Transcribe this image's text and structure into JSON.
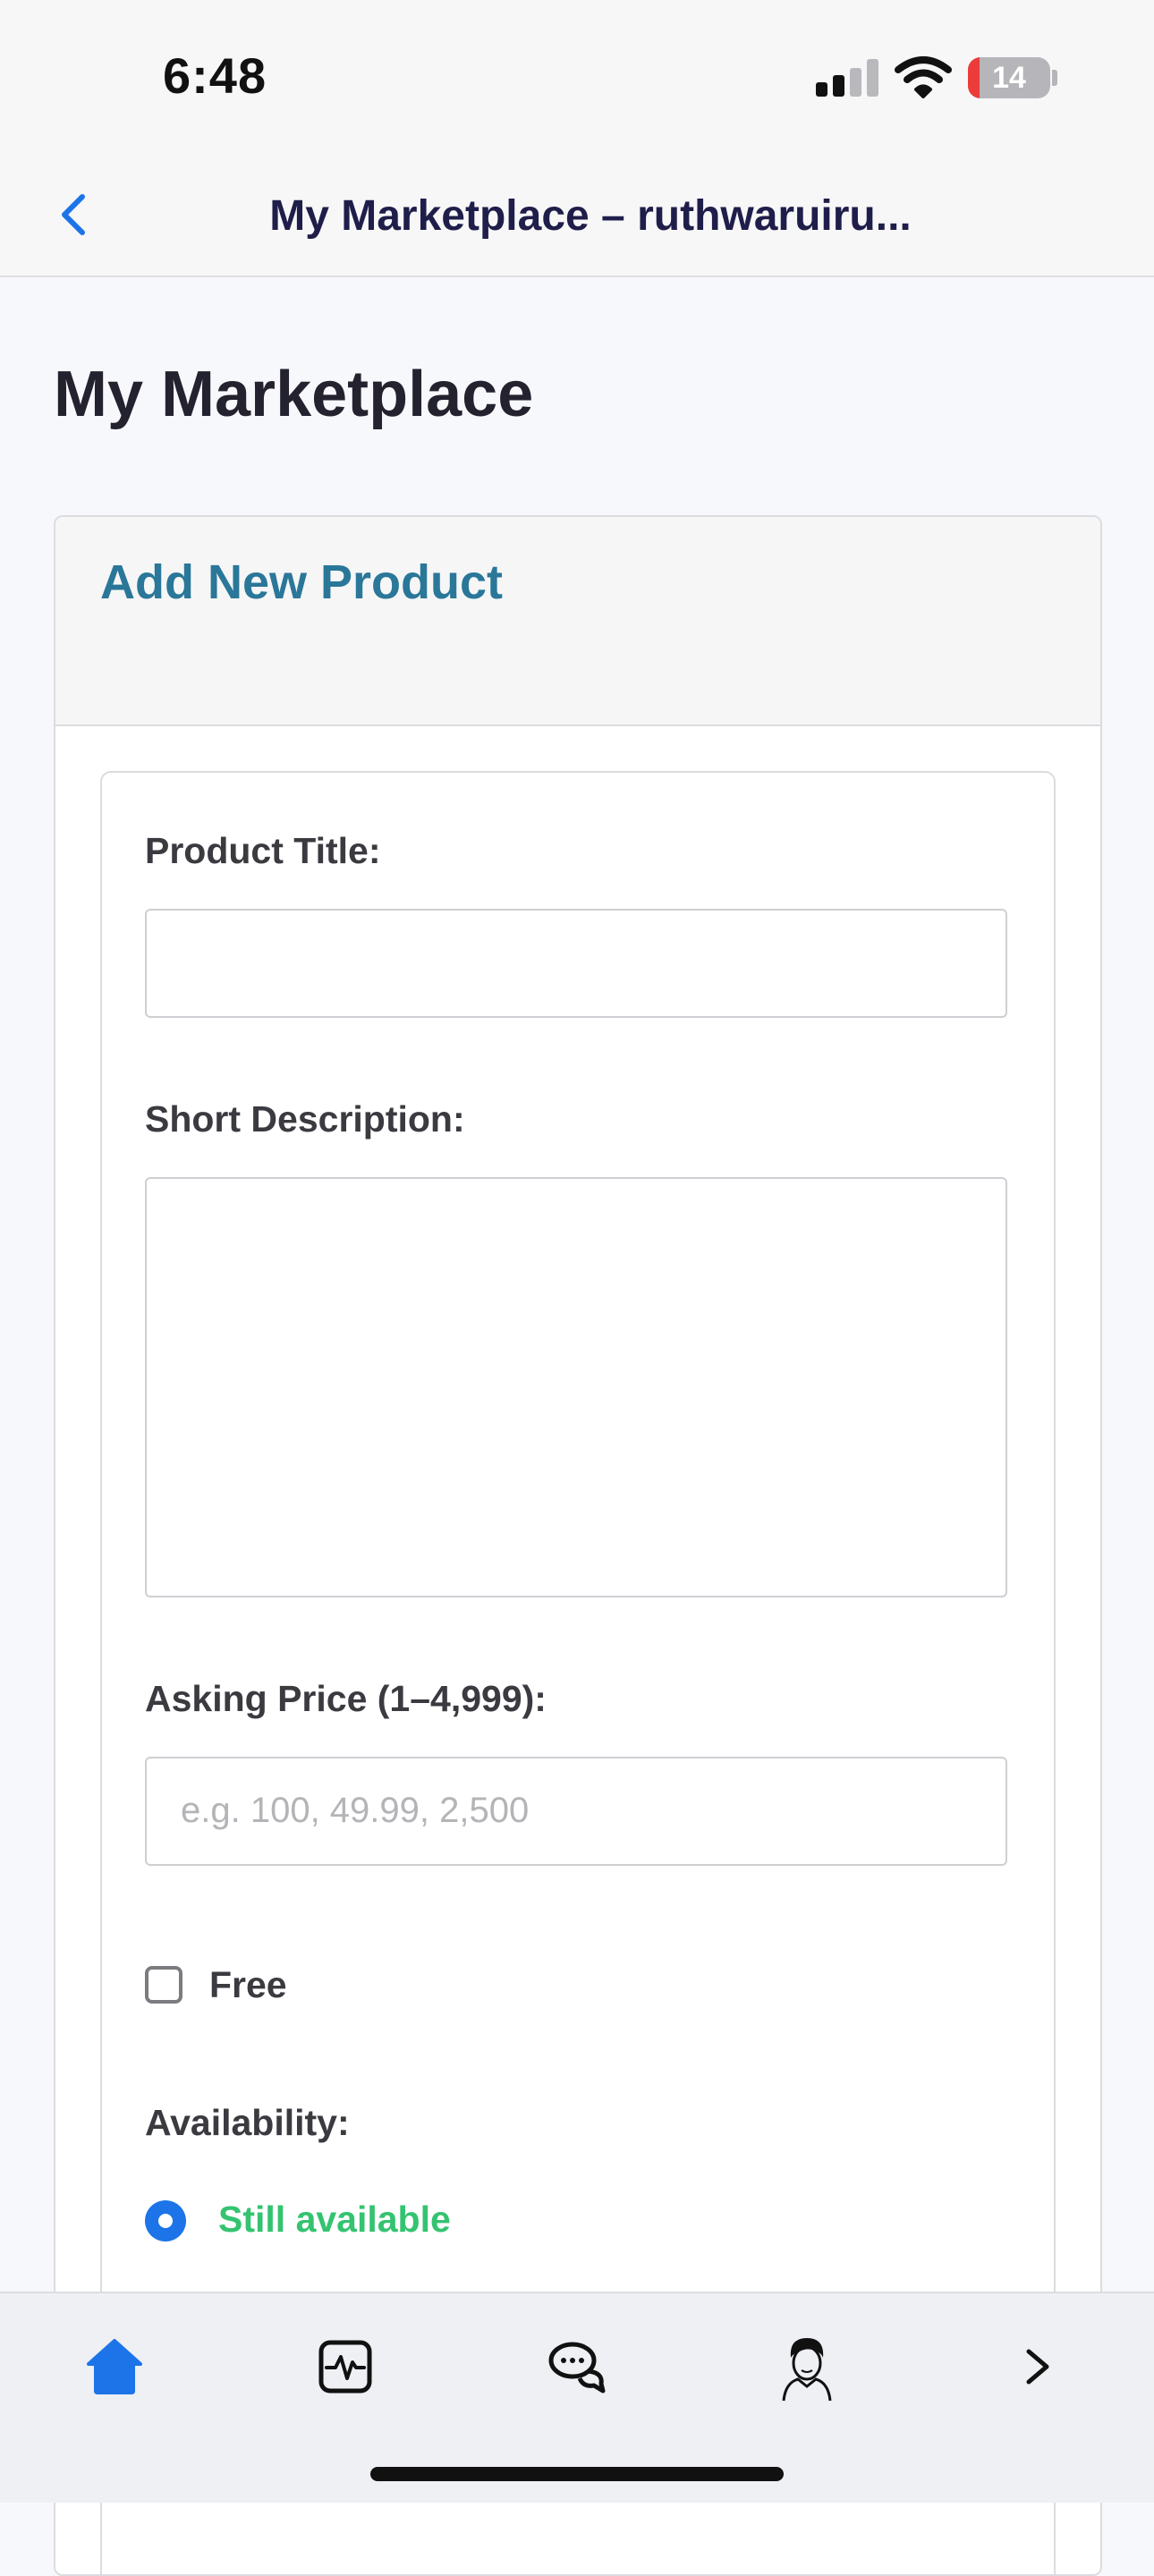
{
  "status_bar": {
    "time": "6:48",
    "battery_level": "14",
    "battery_fill_percent": 14
  },
  "nav": {
    "back_icon": "chevron-left-icon",
    "title": "My Marketplace – ruthwaruiru..."
  },
  "page": {
    "title": "My Marketplace"
  },
  "card": {
    "header_title": "Add New Product"
  },
  "form": {
    "product_title_label": "Product Title:",
    "product_title_value": "",
    "short_description_label": "Short Description:",
    "short_description_value": "",
    "asking_price_label": "Asking Price (1–4,999):",
    "asking_price_placeholder": "e.g. 100, 49.99, 2,500",
    "free_label": "Free",
    "free_checked": false,
    "availability_label": "Availability:",
    "availability_selected": "Still available"
  },
  "tabbar": {
    "items": [
      {
        "icon": "home-icon",
        "active": true,
        "color": "#1d74e8"
      },
      {
        "icon": "activity-icon",
        "active": false
      },
      {
        "icon": "chat-bubbles-icon",
        "active": false
      },
      {
        "icon": "profile-avatar-icon",
        "active": false
      },
      {
        "icon": "chevron-right-icon",
        "active": false
      }
    ]
  },
  "colors": {
    "accent": "#1d74e8",
    "card_title": "#2a7799",
    "available_green": "#34c370",
    "battery_low": "#ec3c3a"
  }
}
